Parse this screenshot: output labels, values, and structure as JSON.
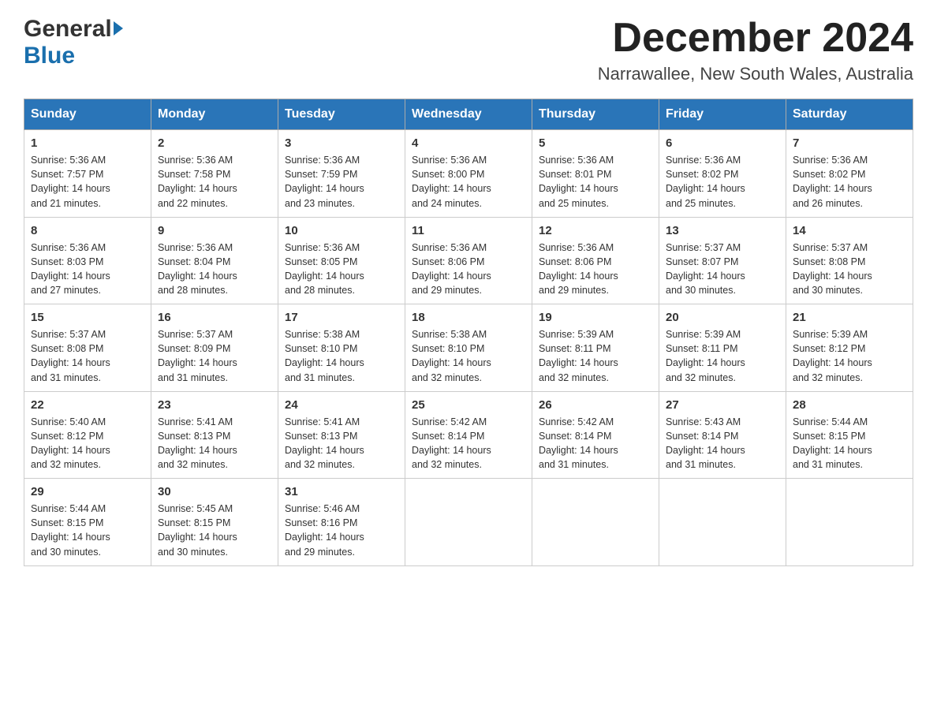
{
  "header": {
    "month_year": "December 2024",
    "location": "Narrawallee, New South Wales, Australia",
    "logo_general": "General",
    "logo_blue": "Blue"
  },
  "weekdays": [
    "Sunday",
    "Monday",
    "Tuesday",
    "Wednesday",
    "Thursday",
    "Friday",
    "Saturday"
  ],
  "days": [
    {
      "date": "1",
      "sunrise": "5:36 AM",
      "sunset": "7:57 PM",
      "daylight": "14 hours and 21 minutes."
    },
    {
      "date": "2",
      "sunrise": "5:36 AM",
      "sunset": "7:58 PM",
      "daylight": "14 hours and 22 minutes."
    },
    {
      "date": "3",
      "sunrise": "5:36 AM",
      "sunset": "7:59 PM",
      "daylight": "14 hours and 23 minutes."
    },
    {
      "date": "4",
      "sunrise": "5:36 AM",
      "sunset": "8:00 PM",
      "daylight": "14 hours and 24 minutes."
    },
    {
      "date": "5",
      "sunrise": "5:36 AM",
      "sunset": "8:01 PM",
      "daylight": "14 hours and 25 minutes."
    },
    {
      "date": "6",
      "sunrise": "5:36 AM",
      "sunset": "8:02 PM",
      "daylight": "14 hours and 25 minutes."
    },
    {
      "date": "7",
      "sunrise": "5:36 AM",
      "sunset": "8:02 PM",
      "daylight": "14 hours and 26 minutes."
    },
    {
      "date": "8",
      "sunrise": "5:36 AM",
      "sunset": "8:03 PM",
      "daylight": "14 hours and 27 minutes."
    },
    {
      "date": "9",
      "sunrise": "5:36 AM",
      "sunset": "8:04 PM",
      "daylight": "14 hours and 28 minutes."
    },
    {
      "date": "10",
      "sunrise": "5:36 AM",
      "sunset": "8:05 PM",
      "daylight": "14 hours and 28 minutes."
    },
    {
      "date": "11",
      "sunrise": "5:36 AM",
      "sunset": "8:06 PM",
      "daylight": "14 hours and 29 minutes."
    },
    {
      "date": "12",
      "sunrise": "5:36 AM",
      "sunset": "8:06 PM",
      "daylight": "14 hours and 29 minutes."
    },
    {
      "date": "13",
      "sunrise": "5:37 AM",
      "sunset": "8:07 PM",
      "daylight": "14 hours and 30 minutes."
    },
    {
      "date": "14",
      "sunrise": "5:37 AM",
      "sunset": "8:08 PM",
      "daylight": "14 hours and 30 minutes."
    },
    {
      "date": "15",
      "sunrise": "5:37 AM",
      "sunset": "8:08 PM",
      "daylight": "14 hours and 31 minutes."
    },
    {
      "date": "16",
      "sunrise": "5:37 AM",
      "sunset": "8:09 PM",
      "daylight": "14 hours and 31 minutes."
    },
    {
      "date": "17",
      "sunrise": "5:38 AM",
      "sunset": "8:10 PM",
      "daylight": "14 hours and 31 minutes."
    },
    {
      "date": "18",
      "sunrise": "5:38 AM",
      "sunset": "8:10 PM",
      "daylight": "14 hours and 32 minutes."
    },
    {
      "date": "19",
      "sunrise": "5:39 AM",
      "sunset": "8:11 PM",
      "daylight": "14 hours and 32 minutes."
    },
    {
      "date": "20",
      "sunrise": "5:39 AM",
      "sunset": "8:11 PM",
      "daylight": "14 hours and 32 minutes."
    },
    {
      "date": "21",
      "sunrise": "5:39 AM",
      "sunset": "8:12 PM",
      "daylight": "14 hours and 32 minutes."
    },
    {
      "date": "22",
      "sunrise": "5:40 AM",
      "sunset": "8:12 PM",
      "daylight": "14 hours and 32 minutes."
    },
    {
      "date": "23",
      "sunrise": "5:41 AM",
      "sunset": "8:13 PM",
      "daylight": "14 hours and 32 minutes."
    },
    {
      "date": "24",
      "sunrise": "5:41 AM",
      "sunset": "8:13 PM",
      "daylight": "14 hours and 32 minutes."
    },
    {
      "date": "25",
      "sunrise": "5:42 AM",
      "sunset": "8:14 PM",
      "daylight": "14 hours and 32 minutes."
    },
    {
      "date": "26",
      "sunrise": "5:42 AM",
      "sunset": "8:14 PM",
      "daylight": "14 hours and 31 minutes."
    },
    {
      "date": "27",
      "sunrise": "5:43 AM",
      "sunset": "8:14 PM",
      "daylight": "14 hours and 31 minutes."
    },
    {
      "date": "28",
      "sunrise": "5:44 AM",
      "sunset": "8:15 PM",
      "daylight": "14 hours and 31 minutes."
    },
    {
      "date": "29",
      "sunrise": "5:44 AM",
      "sunset": "8:15 PM",
      "daylight": "14 hours and 30 minutes."
    },
    {
      "date": "30",
      "sunrise": "5:45 AM",
      "sunset": "8:15 PM",
      "daylight": "14 hours and 30 minutes."
    },
    {
      "date": "31",
      "sunrise": "5:46 AM",
      "sunset": "8:16 PM",
      "daylight": "14 hours and 29 minutes."
    }
  ],
  "labels": {
    "sunrise": "Sunrise:",
    "sunset": "Sunset:",
    "daylight": "Daylight:"
  },
  "colors": {
    "header_bg": "#2a75b8",
    "header_text": "#ffffff",
    "accent": "#1a6fad"
  }
}
